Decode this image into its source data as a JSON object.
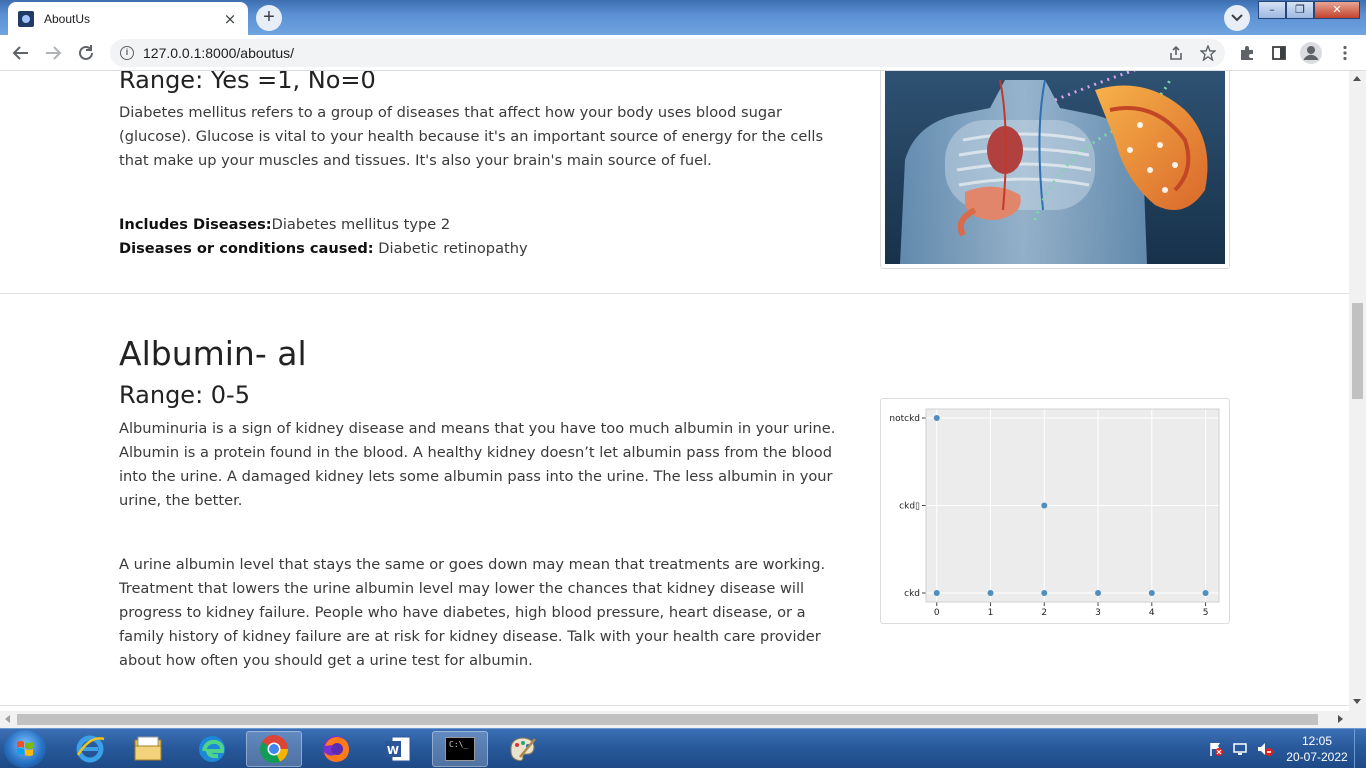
{
  "browser": {
    "tab_title": "AboutUs",
    "tab_close": "×",
    "new_tab": "+",
    "url": "127.0.0.1:8000/aboutus/",
    "window_buttons": [
      "–",
      "❐",
      "✕"
    ]
  },
  "section_diabetes": {
    "range": "Range: Yes =1, No=0",
    "description": "Diabetes mellitus refers to a group of diseases that affect how your body uses blood sugar (glucose). Glucose is vital to your health because it's an important source of energy for the cells that make up your muscles and tissues. It's also your brain's main source of fuel.",
    "includes_label": "Includes Diseases:",
    "includes_value": "Diabetes mellitus type 2",
    "causes_label": "Diseases or conditions caused:",
    "causes_value": " Diabetic retinopathy"
  },
  "section_albumin": {
    "title": "Albumin- al",
    "range": "Range: 0-5",
    "paragraph1": "Albuminuria is a sign of kidney disease and means that you have too much albumin in your urine. Albumin is a protein found in the blood. A healthy kidney doesn’t let albumin pass from the blood into the urine. A damaged kidney lets some albumin pass into the urine. The less albumin in your urine, the better.",
    "paragraph2": "A urine albumin level that stays the same or goes down may mean that treatments are working. Treatment that lowers the urine albumin level may lower the chances that kidney disease will progress to kidney failure. People who have diabetes, high blood pressure, heart disease, or a family history of kidney failure are at risk for kidney disease. Talk with your health care provider about how often you should get a urine test for albumin."
  },
  "chart_data": {
    "type": "scatter",
    "x_ticks": [
      "0",
      "1",
      "2",
      "3",
      "4",
      "5"
    ],
    "y_categories": [
      "ckd",
      "ckd\t",
      "notckd"
    ],
    "y_tick_labels": [
      "ckd",
      "ckd▯",
      "notckd"
    ],
    "xlim": [
      -0.2,
      5.25
    ],
    "points": [
      {
        "x": 0,
        "y": "notckd"
      },
      {
        "x": 2,
        "y": "ckd\t"
      },
      {
        "x": 0,
        "y": "ckd"
      },
      {
        "x": 1,
        "y": "ckd"
      },
      {
        "x": 2,
        "y": "ckd"
      },
      {
        "x": 3,
        "y": "ckd"
      },
      {
        "x": 4,
        "y": "ckd"
      },
      {
        "x": 5,
        "y": "ckd"
      }
    ],
    "grid": true,
    "colors": {
      "point": "#4f8fc0",
      "background": "#ececec",
      "grid": "#ffffff"
    }
  },
  "taskbar": {
    "apps": [
      "explorer-icon",
      "internet-explorer-icon",
      "folder-icon",
      "edge-icon",
      "chrome-icon",
      "firefox-icon",
      "word-icon",
      "cmd-icon",
      "paint-icon"
    ],
    "cmd_label": "C:\\_",
    "time": "12:05",
    "date": "20-07-2022"
  }
}
